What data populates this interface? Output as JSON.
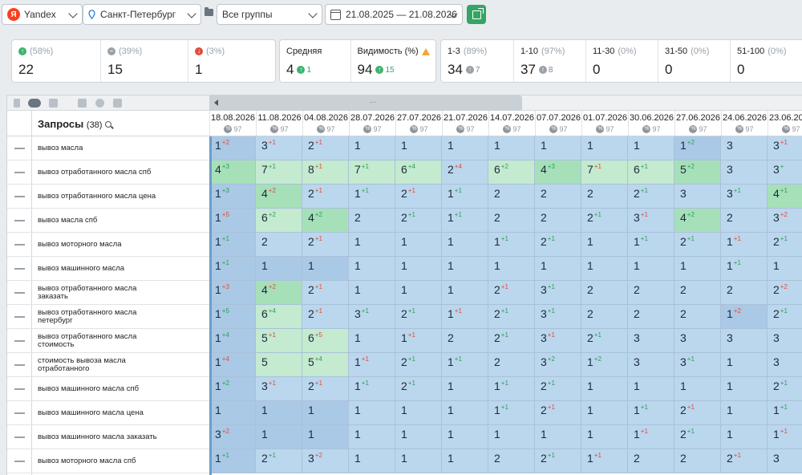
{
  "toolbar": {
    "engine": "Yandex",
    "region": "Санкт-Петербург",
    "group": "Все группы",
    "date_range": "21.08.2025 — 21.08.2026"
  },
  "stats": {
    "up": {
      "pct": "(58%)",
      "value": "22"
    },
    "same": {
      "pct": "(39%)",
      "value": "15"
    },
    "down": {
      "pct": "(3%)",
      "value": "1"
    },
    "average": {
      "label": "Средняя",
      "value": "4",
      "delta": "1"
    },
    "visibility": {
      "label": "Видимость (%)",
      "value": "94",
      "delta": "15"
    },
    "top3": {
      "label": "1-3",
      "pct": "(89%)",
      "value": "34",
      "delta": "7"
    },
    "top10": {
      "label": "1-10",
      "pct": "(97%)",
      "value": "37",
      "delta": "8"
    },
    "top30": {
      "label": "11-30",
      "pct": "(0%)",
      "value": "0"
    },
    "top50": {
      "label": "31-50",
      "pct": "(0%)",
      "value": "0"
    },
    "top100": {
      "label": "51-100",
      "pct": "(0%)",
      "value": "0"
    }
  },
  "table": {
    "title": "Запросы",
    "count": "(38)",
    "dates": [
      "18.08.2026",
      "11.08.2026",
      "04.08.2026",
      "28.07.2026",
      "27.07.2026",
      "21.07.2026",
      "14.07.2026",
      "07.07.2026",
      "01.07.2026",
      "30.06.2026",
      "27.06.2026",
      "24.06.2026",
      "23.06.2026"
    ],
    "date_sub": "97",
    "queries": [
      "вывоз масла",
      "вывоз отработанного масла спб",
      "вывоз отработанного масла цена",
      "вывоз масла спб",
      "вывоз моторного масла",
      "вывоз машинного масла",
      "вывоз отработанного масла заказать",
      "вывоз отработанного масла петербург",
      "вывоз отработанного масла стоимость",
      "стоимость вывоза масла отработанного",
      "вывоз машинного масла спб",
      "вывоз машинного масла цена",
      "вывоз машинного масла заказать",
      "вывоз моторного масла спб"
    ],
    "cells": [
      [
        [
          "1",
          "+2",
          "b1"
        ],
        [
          "3",
          "+1",
          "b2"
        ],
        [
          "2",
          "+1",
          "b2"
        ],
        [
          "1",
          "",
          "b2"
        ],
        [
          "1",
          "",
          "b2"
        ],
        [
          "1",
          "",
          "b2"
        ],
        [
          "1",
          "",
          "b2"
        ],
        [
          "1",
          "",
          "b2"
        ],
        [
          "1",
          "",
          "b2"
        ],
        [
          "1",
          "",
          "b2"
        ],
        [
          "1",
          "+2",
          "b1"
        ],
        [
          "3",
          "",
          "b2"
        ],
        [
          "3",
          "+1",
          "b2"
        ]
      ],
      [
        [
          "4",
          "+3",
          "g1"
        ],
        [
          "7",
          "+1",
          "g2"
        ],
        [
          "8",
          "+1",
          "g2"
        ],
        [
          "7",
          "+1",
          "g2"
        ],
        [
          "6",
          "+4",
          "g2"
        ],
        [
          "2",
          "+4",
          "b2"
        ],
        [
          "6",
          "+2",
          "g2"
        ],
        [
          "4",
          "+3",
          "g1"
        ],
        [
          "7",
          "+1",
          "g2"
        ],
        [
          "6",
          "+1",
          "g2"
        ],
        [
          "5",
          "+2",
          "g1"
        ],
        [
          "3",
          "",
          "b2"
        ],
        [
          "3",
          "+",
          "b2"
        ]
      ],
      [
        [
          "1",
          "+3",
          "b1"
        ],
        [
          "4",
          "+2",
          "g1"
        ],
        [
          "2",
          "+1",
          "b2"
        ],
        [
          "1",
          "+1",
          "b2"
        ],
        [
          "2",
          "+1",
          "b2"
        ],
        [
          "1",
          "+1",
          "b2"
        ],
        [
          "2",
          "",
          "b2"
        ],
        [
          "2",
          "",
          "b2"
        ],
        [
          "2",
          "",
          "b2"
        ],
        [
          "2",
          "+1",
          "b2"
        ],
        [
          "3",
          "",
          "b2"
        ],
        [
          "3",
          "+1",
          "b2"
        ],
        [
          "4",
          "+1",
          "g1"
        ]
      ],
      [
        [
          "1",
          "+5",
          "b1"
        ],
        [
          "6",
          "+2",
          "g2"
        ],
        [
          "4",
          "+2",
          "g1"
        ],
        [
          "2",
          "",
          "b2"
        ],
        [
          "2",
          "+1",
          "b2"
        ],
        [
          "1",
          "+1",
          "b2"
        ],
        [
          "2",
          "",
          "b2"
        ],
        [
          "2",
          "",
          "b2"
        ],
        [
          "2",
          "+1",
          "b2"
        ],
        [
          "3",
          "+1",
          "b2"
        ],
        [
          "4",
          "+2",
          "g1"
        ],
        [
          "2",
          "",
          "b2"
        ],
        [
          "3",
          "+2",
          "b2"
        ]
      ],
      [
        [
          "1",
          "+1",
          "b1"
        ],
        [
          "2",
          "",
          "b2"
        ],
        [
          "2",
          "+1",
          "b2"
        ],
        [
          "1",
          "",
          "b2"
        ],
        [
          "1",
          "",
          "b2"
        ],
        [
          "1",
          "",
          "b2"
        ],
        [
          "1",
          "+1",
          "b2"
        ],
        [
          "2",
          "+1",
          "b2"
        ],
        [
          "1",
          "",
          "b2"
        ],
        [
          "1",
          "+1",
          "b2"
        ],
        [
          "2",
          "+1",
          "b2"
        ],
        [
          "1",
          "+1",
          "b2"
        ],
        [
          "2",
          "+1",
          "b2"
        ]
      ],
      [
        [
          "1",
          "+1",
          "b1"
        ],
        [
          "1",
          "",
          "b1"
        ],
        [
          "1",
          "",
          "b1"
        ],
        [
          "1",
          "",
          "b2"
        ],
        [
          "1",
          "",
          "b2"
        ],
        [
          "1",
          "",
          "b2"
        ],
        [
          "1",
          "",
          "b2"
        ],
        [
          "1",
          "",
          "b2"
        ],
        [
          "1",
          "",
          "b2"
        ],
        [
          "1",
          "",
          "b2"
        ],
        [
          "1",
          "",
          "b2"
        ],
        [
          "1",
          "+1",
          "b2"
        ],
        [
          "1",
          "",
          "b2"
        ]
      ],
      [
        [
          "1",
          "+3",
          "b1"
        ],
        [
          "4",
          "+2",
          "g1"
        ],
        [
          "2",
          "+1",
          "b2"
        ],
        [
          "1",
          "",
          "b2"
        ],
        [
          "1",
          "",
          "b2"
        ],
        [
          "1",
          "",
          "b2"
        ],
        [
          "2",
          "+1",
          "b2"
        ],
        [
          "3",
          "+1",
          "b2"
        ],
        [
          "2",
          "",
          "b2"
        ],
        [
          "2",
          "",
          "b2"
        ],
        [
          "2",
          "",
          "b2"
        ],
        [
          "2",
          "",
          "b2"
        ],
        [
          "2",
          "+2",
          "b2"
        ]
      ],
      [
        [
          "1",
          "+5",
          "b1"
        ],
        [
          "6",
          "+4",
          "g2"
        ],
        [
          "2",
          "+1",
          "b2"
        ],
        [
          "3",
          "+1",
          "b2"
        ],
        [
          "2",
          "+1",
          "b2"
        ],
        [
          "1",
          "+1",
          "b2"
        ],
        [
          "2",
          "+1",
          "b2"
        ],
        [
          "3",
          "+1",
          "b2"
        ],
        [
          "2",
          "",
          "b2"
        ],
        [
          "2",
          "",
          "b2"
        ],
        [
          "2",
          "",
          "b2"
        ],
        [
          "1",
          "+2",
          "b1"
        ],
        [
          "2",
          "+1",
          "b2"
        ]
      ],
      [
        [
          "1",
          "+4",
          "b1"
        ],
        [
          "5",
          "+1",
          "g2"
        ],
        [
          "6",
          "+5",
          "g2"
        ],
        [
          "1",
          "",
          "b2"
        ],
        [
          "1",
          "+1",
          "b2"
        ],
        [
          "2",
          "",
          "b2"
        ],
        [
          "2",
          "+1",
          "b2"
        ],
        [
          "3",
          "+1",
          "b2"
        ],
        [
          "2",
          "+1",
          "b2"
        ],
        [
          "3",
          "",
          "b2"
        ],
        [
          "3",
          "",
          "b2"
        ],
        [
          "3",
          "",
          "b2"
        ],
        [
          "3",
          "",
          "b2"
        ]
      ],
      [
        [
          "1",
          "+4",
          "b1"
        ],
        [
          "5",
          "",
          "g2"
        ],
        [
          "5",
          "+4",
          "g2"
        ],
        [
          "1",
          "+1",
          "b2"
        ],
        [
          "2",
          "+1",
          "b2"
        ],
        [
          "1",
          "+1",
          "b2"
        ],
        [
          "2",
          "",
          "b2"
        ],
        [
          "3",
          "+2",
          "b2"
        ],
        [
          "1",
          "+2",
          "b2"
        ],
        [
          "3",
          "",
          "b2"
        ],
        [
          "3",
          "+1",
          "b2"
        ],
        [
          "1",
          "",
          "b2"
        ],
        [
          "3",
          "",
          "b2"
        ]
      ],
      [
        [
          "1",
          "+2",
          "b1"
        ],
        [
          "3",
          "+1",
          "b2"
        ],
        [
          "2",
          "+1",
          "b2"
        ],
        [
          "1",
          "+1",
          "b2"
        ],
        [
          "2",
          "+1",
          "b2"
        ],
        [
          "1",
          "",
          "b2"
        ],
        [
          "1",
          "+1",
          "b2"
        ],
        [
          "2",
          "+1",
          "b2"
        ],
        [
          "1",
          "",
          "b2"
        ],
        [
          "1",
          "",
          "b2"
        ],
        [
          "1",
          "",
          "b2"
        ],
        [
          "1",
          "",
          "b2"
        ],
        [
          "2",
          "+1",
          "b2"
        ]
      ],
      [
        [
          "1",
          "",
          "b1"
        ],
        [
          "1",
          "",
          "b1"
        ],
        [
          "1",
          "",
          "b1"
        ],
        [
          "1",
          "",
          "b2"
        ],
        [
          "1",
          "",
          "b2"
        ],
        [
          "1",
          "",
          "b2"
        ],
        [
          "1",
          "+1",
          "b2"
        ],
        [
          "2",
          "+1",
          "b2"
        ],
        [
          "1",
          "",
          "b2"
        ],
        [
          "1",
          "+1",
          "b2"
        ],
        [
          "2",
          "+1",
          "b2"
        ],
        [
          "1",
          "",
          "b2"
        ],
        [
          "1",
          "+1",
          "b2"
        ]
      ],
      [
        [
          "3",
          "+2",
          "b1"
        ],
        [
          "1",
          "",
          "b1"
        ],
        [
          "1",
          "",
          "b1"
        ],
        [
          "1",
          "",
          "b2"
        ],
        [
          "1",
          "",
          "b2"
        ],
        [
          "1",
          "",
          "b2"
        ],
        [
          "1",
          "",
          "b2"
        ],
        [
          "1",
          "",
          "b2"
        ],
        [
          "1",
          "",
          "b2"
        ],
        [
          "1",
          "+1",
          "b2"
        ],
        [
          "2",
          "+1",
          "b2"
        ],
        [
          "1",
          "",
          "b2"
        ],
        [
          "1",
          "+1",
          "b2"
        ]
      ],
      [
        [
          "1",
          "+1",
          "b1"
        ],
        [
          "2",
          "+1",
          "b2"
        ],
        [
          "3",
          "+2",
          "b2"
        ],
        [
          "1",
          "",
          "b2"
        ],
        [
          "1",
          "",
          "b2"
        ],
        [
          "1",
          "",
          "b2"
        ],
        [
          "2",
          "",
          "b2"
        ],
        [
          "2",
          "+1",
          "b2"
        ],
        [
          "1",
          "+1",
          "b2"
        ],
        [
          "2",
          "",
          "b2"
        ],
        [
          "2",
          "",
          "b2"
        ],
        [
          "2",
          "+1",
          "b2"
        ],
        [
          "3",
          "",
          "b2"
        ]
      ]
    ]
  }
}
